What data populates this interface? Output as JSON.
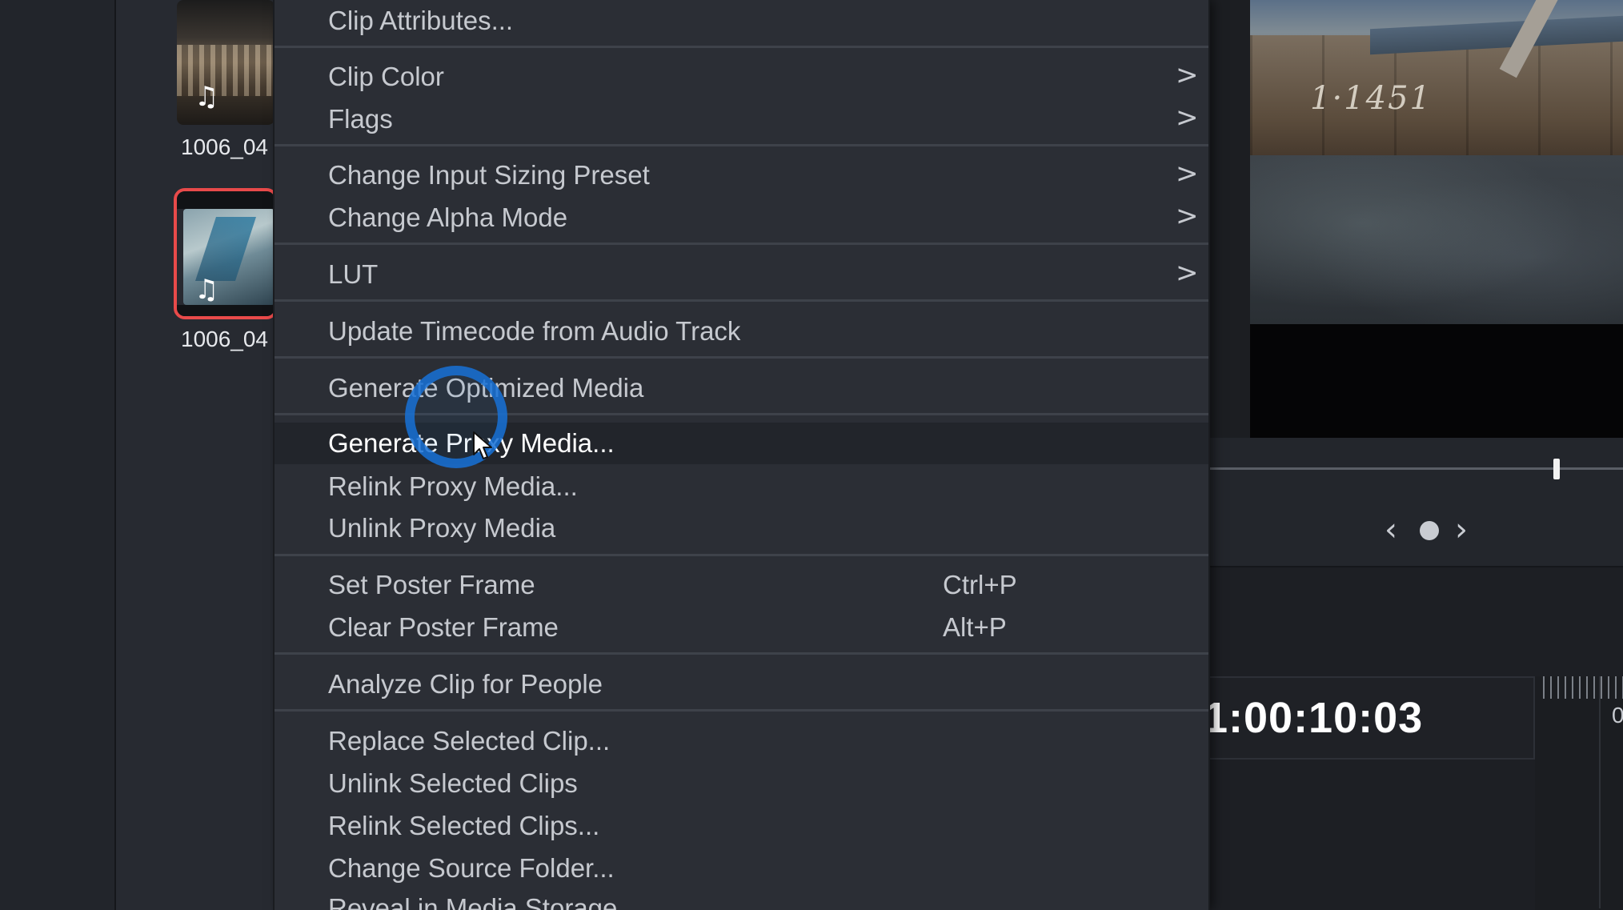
{
  "media_pool": {
    "clips": [
      {
        "name": "1006_04",
        "selected": false,
        "icon": "music-note-icon"
      },
      {
        "name": "1006_04",
        "selected": true,
        "icon": "music-note-icon"
      }
    ]
  },
  "context_menu": {
    "items": [
      {
        "label": "Clip Attributes...",
        "submenu": false,
        "shortcut": ""
      },
      {
        "label": "Clip Color",
        "submenu": true,
        "shortcut": ""
      },
      {
        "label": "Flags",
        "submenu": true,
        "shortcut": ""
      },
      {
        "label": "Change Input Sizing Preset",
        "submenu": true,
        "shortcut": ""
      },
      {
        "label": "Change Alpha Mode",
        "submenu": true,
        "shortcut": ""
      },
      {
        "label": "LUT",
        "submenu": true,
        "shortcut": ""
      },
      {
        "label": "Update Timecode from Audio Track",
        "submenu": false,
        "shortcut": ""
      },
      {
        "label": "Generate Optimized Media",
        "submenu": false,
        "shortcut": ""
      },
      {
        "label": "Generate Proxy Media...",
        "submenu": false,
        "shortcut": "",
        "highlighted": true
      },
      {
        "label": "Relink Proxy Media...",
        "submenu": false,
        "shortcut": ""
      },
      {
        "label": "Unlink Proxy Media",
        "submenu": false,
        "shortcut": ""
      },
      {
        "label": "Set Poster Frame",
        "submenu": false,
        "shortcut": "Ctrl+P"
      },
      {
        "label": "Clear Poster Frame",
        "submenu": false,
        "shortcut": "Alt+P"
      },
      {
        "label": "Analyze Clip for People",
        "submenu": false,
        "shortcut": ""
      },
      {
        "label": "Replace Selected Clip...",
        "submenu": false,
        "shortcut": ""
      },
      {
        "label": "Unlink Selected Clips",
        "submenu": false,
        "shortcut": ""
      },
      {
        "label": "Relink Selected Clips...",
        "submenu": false,
        "shortcut": ""
      },
      {
        "label": "Change Source Folder...",
        "submenu": false,
        "shortcut": ""
      },
      {
        "label": "Reveal in Media Storage",
        "submenu": false,
        "shortcut": ""
      }
    ],
    "chevron_glyph": ">"
  },
  "viewer": {
    "wall_text": "1·1451",
    "timecode": "1:00:10:03",
    "nav_prev": "‹",
    "nav_next": "›",
    "ruler_label": "0"
  },
  "colors": {
    "menu_bg": "#2b2e35",
    "menu_highlight": "#22252b",
    "selection_outline": "#e84a4a",
    "click_ring": "#1871d6"
  }
}
